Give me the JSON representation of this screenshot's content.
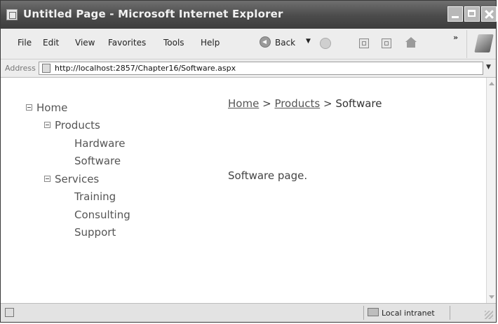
{
  "window": {
    "title": "Untitled Page - Microsoft Internet Explorer"
  },
  "menubar": {
    "items": [
      {
        "label": "File"
      },
      {
        "label": "Edit"
      },
      {
        "label": "View"
      },
      {
        "label": "Favorites"
      },
      {
        "label": "Tools"
      },
      {
        "label": "Help"
      }
    ],
    "back_label": "Back",
    "chevron": "»"
  },
  "address": {
    "label": "Address",
    "url": "http://localhost:2857/Chapter16/Software.aspx"
  },
  "tree": {
    "home": "Home",
    "products": "Products",
    "hardware": "Hardware",
    "software": "Software",
    "services": "Services",
    "training": "Training",
    "consulting": "Consulting",
    "support": "Support"
  },
  "breadcrumb": {
    "home": "Home",
    "products": "Products",
    "current": "Software",
    "separator": ">"
  },
  "page": {
    "message": "Software page."
  },
  "status": {
    "zone": "Local intranet"
  }
}
